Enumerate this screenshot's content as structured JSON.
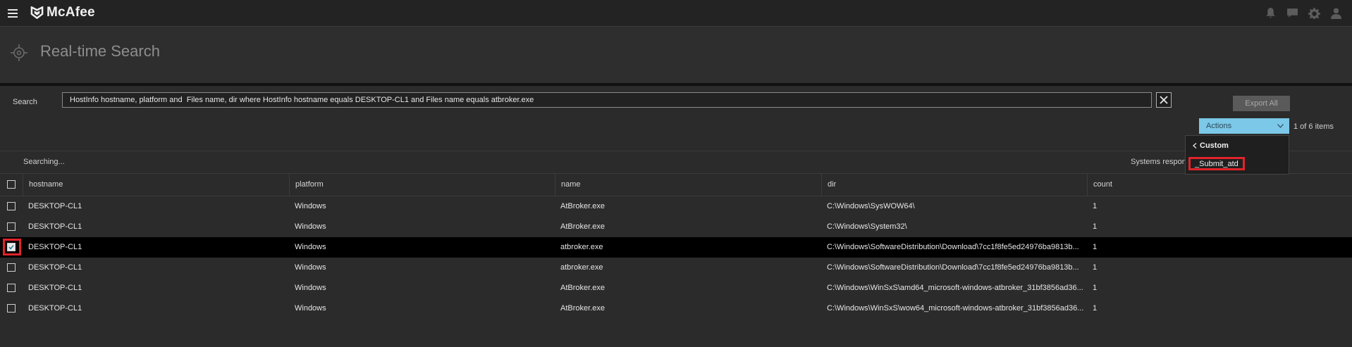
{
  "app": {
    "brand": "McAfee",
    "top_icons": [
      "bell-icon",
      "chat-icon",
      "gear-icon",
      "user-icon"
    ]
  },
  "page": {
    "title": "Real-time Search",
    "icon": "crosshair-icon"
  },
  "search": {
    "label": "Search",
    "query": "HostInfo hostname, platform and  Files name, dir where HostInfo hostname equals DESKTOP-CL1 and Files name equals atbroker.exe",
    "export_label": "Export All",
    "actions_label": "Actions",
    "items_count": "1 of 6 items"
  },
  "status": {
    "searching": "Searching...",
    "systems_responded": "Systems respon"
  },
  "actions_menu": {
    "back_label": "Custom",
    "items": [
      "_Submit_atd"
    ]
  },
  "table": {
    "columns": [
      "hostname",
      "platform",
      "name",
      "dir",
      "count"
    ],
    "rows": [
      {
        "hostname": "DESKTOP-CL1",
        "platform": "Windows",
        "name": "AtBroker.exe",
        "dir": "C:\\Windows\\SysWOW64\\",
        "count": "1",
        "checked": false
      },
      {
        "hostname": "DESKTOP-CL1",
        "platform": "Windows",
        "name": "AtBroker.exe",
        "dir": "C:\\Windows\\System32\\",
        "count": "1",
        "checked": false
      },
      {
        "hostname": "DESKTOP-CL1",
        "platform": "Windows",
        "name": "atbroker.exe",
        "dir": "C:\\Windows\\SoftwareDistribution\\Download\\7cc1f8fe5ed24976ba9813b...",
        "count": "1",
        "checked": true
      },
      {
        "hostname": "DESKTOP-CL1",
        "platform": "Windows",
        "name": "atbroker.exe",
        "dir": "C:\\Windows\\SoftwareDistribution\\Download\\7cc1f8fe5ed24976ba9813b...",
        "count": "1",
        "checked": false
      },
      {
        "hostname": "DESKTOP-CL1",
        "platform": "Windows",
        "name": "AtBroker.exe",
        "dir": "C:\\Windows\\WinSxS\\amd64_microsoft-windows-atbroker_31bf3856ad36...",
        "count": "1",
        "checked": false
      },
      {
        "hostname": "DESKTOP-CL1",
        "platform": "Windows",
        "name": "AtBroker.exe",
        "dir": "C:\\Windows\\WinSxS\\wow64_microsoft-windows-atbroker_31bf3856ad36...",
        "count": "1",
        "checked": false
      }
    ]
  },
  "colors": {
    "accent_actions": "#7cc8e8",
    "highlight": "#e0242a",
    "selected_row": "#000000"
  }
}
